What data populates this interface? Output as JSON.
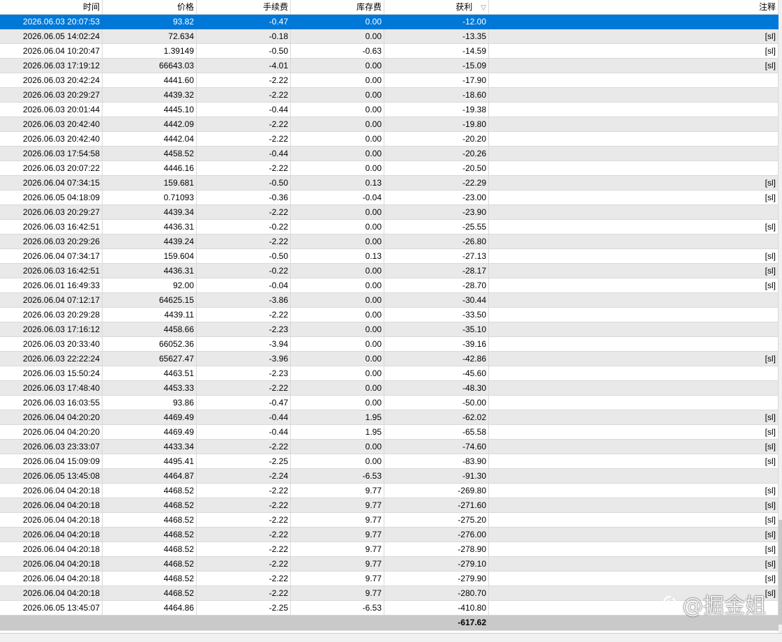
{
  "columns": {
    "time": "时间",
    "price": "价格",
    "fee": "手续费",
    "swap": "库存费",
    "profit": "获利",
    "profit_sort_icon": "sort-down-icon",
    "note": "注释"
  },
  "selected_row_index": 0,
  "rows": [
    {
      "time": "2026.06.03 20:07:53",
      "price": "93.82",
      "fee": "-0.47",
      "swap": "0.00",
      "profit": "-12.00",
      "note": ""
    },
    {
      "time": "2026.06.05 14:02:24",
      "price": "72.634",
      "fee": "-0.18",
      "swap": "0.00",
      "profit": "-13.35",
      "note": "[sl]"
    },
    {
      "time": "2026.06.04 10:20:47",
      "price": "1.39149",
      "fee": "-0.50",
      "swap": "-0.63",
      "profit": "-14.59",
      "note": "[sl]"
    },
    {
      "time": "2026.06.03 17:19:12",
      "price": "66643.03",
      "fee": "-4.01",
      "swap": "0.00",
      "profit": "-15.09",
      "note": "[sl]"
    },
    {
      "time": "2026.06.03 20:42:24",
      "price": "4441.60",
      "fee": "-2.22",
      "swap": "0.00",
      "profit": "-17.90",
      "note": ""
    },
    {
      "time": "2026.06.03 20:29:27",
      "price": "4439.32",
      "fee": "-2.22",
      "swap": "0.00",
      "profit": "-18.60",
      "note": ""
    },
    {
      "time": "2026.06.03 20:01:44",
      "price": "4445.10",
      "fee": "-0.44",
      "swap": "0.00",
      "profit": "-19.38",
      "note": ""
    },
    {
      "time": "2026.06.03 20:42:40",
      "price": "4442.09",
      "fee": "-2.22",
      "swap": "0.00",
      "profit": "-19.80",
      "note": ""
    },
    {
      "time": "2026.06.03 20:42:40",
      "price": "4442.04",
      "fee": "-2.22",
      "swap": "0.00",
      "profit": "-20.20",
      "note": ""
    },
    {
      "time": "2026.06.03 17:54:58",
      "price": "4458.52",
      "fee": "-0.44",
      "swap": "0.00",
      "profit": "-20.26",
      "note": ""
    },
    {
      "time": "2026.06.03 20:07:22",
      "price": "4446.16",
      "fee": "-2.22",
      "swap": "0.00",
      "profit": "-20.50",
      "note": ""
    },
    {
      "time": "2026.06.04 07:34:15",
      "price": "159.681",
      "fee": "-0.50",
      "swap": "0.13",
      "profit": "-22.29",
      "note": "[sl]"
    },
    {
      "time": "2026.06.05 04:18:09",
      "price": "0.71093",
      "fee": "-0.36",
      "swap": "-0.04",
      "profit": "-23.00",
      "note": "[sl]"
    },
    {
      "time": "2026.06.03 20:29:27",
      "price": "4439.34",
      "fee": "-2.22",
      "swap": "0.00",
      "profit": "-23.90",
      "note": ""
    },
    {
      "time": "2026.06.03 16:42:51",
      "price": "4436.31",
      "fee": "-0.22",
      "swap": "0.00",
      "profit": "-25.55",
      "note": "[sl]"
    },
    {
      "time": "2026.06.03 20:29:26",
      "price": "4439.24",
      "fee": "-2.22",
      "swap": "0.00",
      "profit": "-26.80",
      "note": ""
    },
    {
      "time": "2026.06.04 07:34:17",
      "price": "159.604",
      "fee": "-0.50",
      "swap": "0.13",
      "profit": "-27.13",
      "note": "[sl]"
    },
    {
      "time": "2026.06.03 16:42:51",
      "price": "4436.31",
      "fee": "-0.22",
      "swap": "0.00",
      "profit": "-28.17",
      "note": "[sl]"
    },
    {
      "time": "2026.06.01 16:49:33",
      "price": "92.00",
      "fee": "-0.04",
      "swap": "0.00",
      "profit": "-28.70",
      "note": "[sl]"
    },
    {
      "time": "2026.06.04 07:12:17",
      "price": "64625.15",
      "fee": "-3.86",
      "swap": "0.00",
      "profit": "-30.44",
      "note": ""
    },
    {
      "time": "2026.06.03 20:29:28",
      "price": "4439.11",
      "fee": "-2.22",
      "swap": "0.00",
      "profit": "-33.50",
      "note": ""
    },
    {
      "time": "2026.06.03 17:16:12",
      "price": "4458.66",
      "fee": "-2.23",
      "swap": "0.00",
      "profit": "-35.10",
      "note": ""
    },
    {
      "time": "2026.06.03 20:33:40",
      "price": "66052.36",
      "fee": "-3.94",
      "swap": "0.00",
      "profit": "-39.16",
      "note": ""
    },
    {
      "time": "2026.06.03 22:22:24",
      "price": "65627.47",
      "fee": "-3.96",
      "swap": "0.00",
      "profit": "-42.86",
      "note": "[sl]"
    },
    {
      "time": "2026.06.03 15:50:24",
      "price": "4463.51",
      "fee": "-2.23",
      "swap": "0.00",
      "profit": "-45.60",
      "note": ""
    },
    {
      "time": "2026.06.03 17:48:40",
      "price": "4453.33",
      "fee": "-2.22",
      "swap": "0.00",
      "profit": "-48.30",
      "note": ""
    },
    {
      "time": "2026.06.03 16:03:55",
      "price": "93.86",
      "fee": "-0.47",
      "swap": "0.00",
      "profit": "-50.00",
      "note": ""
    },
    {
      "time": "2026.06.04 04:20:20",
      "price": "4469.49",
      "fee": "-0.44",
      "swap": "1.95",
      "profit": "-62.02",
      "note": "[sl]"
    },
    {
      "time": "2026.06.04 04:20:20",
      "price": "4469.49",
      "fee": "-0.44",
      "swap": "1.95",
      "profit": "-65.58",
      "note": "[sl]"
    },
    {
      "time": "2026.06.03 23:33:07",
      "price": "4433.34",
      "fee": "-2.22",
      "swap": "0.00",
      "profit": "-74.60",
      "note": "[sl]"
    },
    {
      "time": "2026.06.04 15:09:09",
      "price": "4495.41",
      "fee": "-2.25",
      "swap": "0.00",
      "profit": "-83.90",
      "note": "[sl]"
    },
    {
      "time": "2026.06.05 13:45:08",
      "price": "4464.87",
      "fee": "-2.24",
      "swap": "-6.53",
      "profit": "-91.30",
      "note": ""
    },
    {
      "time": "2026.06.04 04:20:18",
      "price": "4468.52",
      "fee": "-2.22",
      "swap": "9.77",
      "profit": "-269.80",
      "note": "[sl]"
    },
    {
      "time": "2026.06.04 04:20:18",
      "price": "4468.52",
      "fee": "-2.22",
      "swap": "9.77",
      "profit": "-271.60",
      "note": "[sl]"
    },
    {
      "time": "2026.06.04 04:20:18",
      "price": "4468.52",
      "fee": "-2.22",
      "swap": "9.77",
      "profit": "-275.20",
      "note": "[sl]"
    },
    {
      "time": "2026.06.04 04:20:18",
      "price": "4468.52",
      "fee": "-2.22",
      "swap": "9.77",
      "profit": "-276.00",
      "note": "[sl]"
    },
    {
      "time": "2026.06.04 04:20:18",
      "price": "4468.52",
      "fee": "-2.22",
      "swap": "9.77",
      "profit": "-278.90",
      "note": "[sl]"
    },
    {
      "time": "2026.06.04 04:20:18",
      "price": "4468.52",
      "fee": "-2.22",
      "swap": "9.77",
      "profit": "-279.10",
      "note": "[sl]"
    },
    {
      "time": "2026.06.04 04:20:18",
      "price": "4468.52",
      "fee": "-2.22",
      "swap": "9.77",
      "profit": "-279.90",
      "note": "[sl]"
    },
    {
      "time": "2026.06.04 04:20:18",
      "price": "4468.52",
      "fee": "-2.22",
      "swap": "9.77",
      "profit": "-280.70",
      "note": "[sl]"
    },
    {
      "time": "2026.06.05 13:45:07",
      "price": "4464.86",
      "fee": "-2.25",
      "swap": "-6.53",
      "profit": "-410.80",
      "note": ""
    }
  ],
  "total": {
    "profit": "-617.62"
  },
  "watermark": {
    "icon": "social-logo-icon",
    "text": "@掘金姐"
  },
  "colors": {
    "selection": "#0078d7",
    "alt_row": "#e9e9e9",
    "total_row": "#c9c9c9"
  }
}
